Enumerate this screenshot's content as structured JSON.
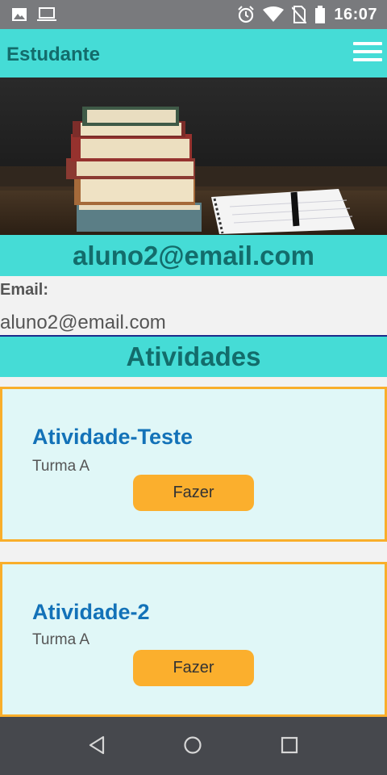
{
  "status_bar": {
    "time": "16:07",
    "icons": [
      "image-icon",
      "laptop-icon",
      "alarm-icon",
      "wifi-icon",
      "no-sim-icon",
      "battery-icon"
    ]
  },
  "app_bar": {
    "title": "Estudante",
    "menu_icon": "hamburger-menu-icon"
  },
  "hero": {
    "icon": "books-photo"
  },
  "profile": {
    "email_heading": "aluno2@email.com",
    "email_label": "Email:",
    "email_value": "aluno2@email.com"
  },
  "activities": {
    "heading": "Atividades",
    "items": [
      {
        "title": "Atividade-Teste",
        "class": "Turma A",
        "button": "Fazer"
      },
      {
        "title": "Atividade-2",
        "class": "Turma A",
        "button": "Fazer"
      }
    ]
  },
  "navigation": {
    "back_icon": "back-icon",
    "home_icon": "home-icon",
    "recents_icon": "recents-icon"
  },
  "colors": {
    "accent": "#45dcd6",
    "accent_text": "#136c6b",
    "card_border": "#f9ae2b",
    "button": "#fbaf2d",
    "title_blue": "#1372b8"
  }
}
